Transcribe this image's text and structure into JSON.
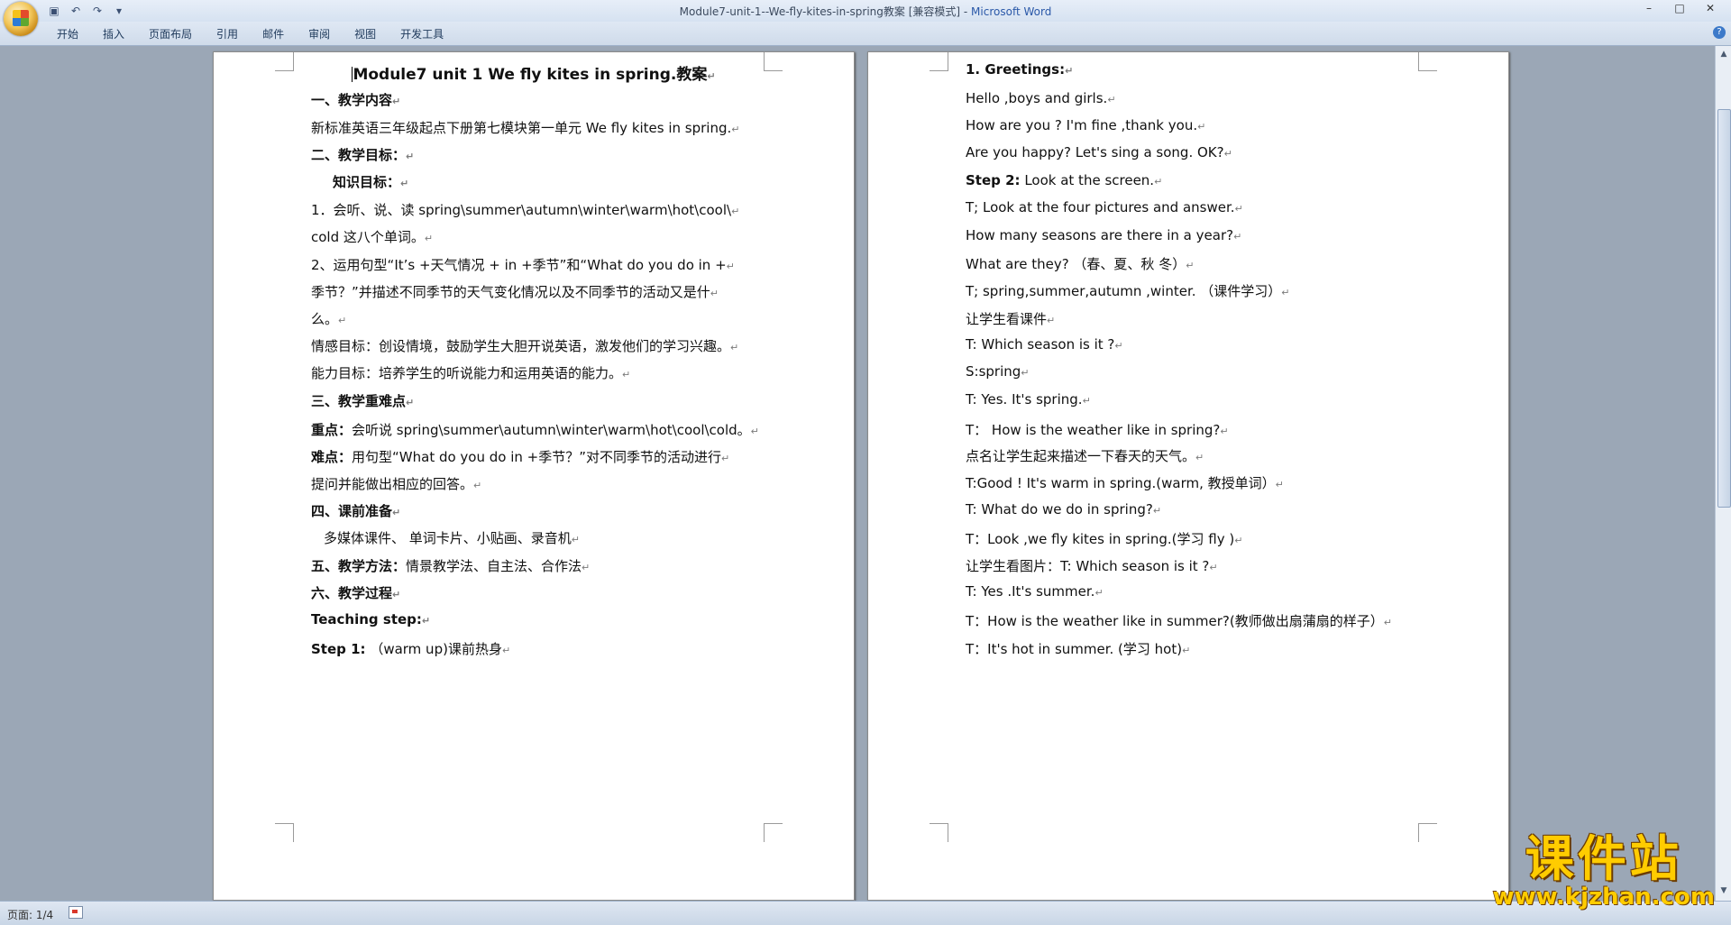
{
  "window": {
    "title": "Module7-unit-1--We-fly-kites-in-spring教案 [兼容模式] - ",
    "app_name": "Microsoft Word",
    "controls": [
      "–",
      "□",
      "✕"
    ]
  },
  "quick_access": [
    "save-icon",
    "undo-icon",
    "redo-icon",
    "customize-icon"
  ],
  "ribbon": {
    "tabs": [
      "开始",
      "插入",
      "页面布局",
      "引用",
      "邮件",
      "审阅",
      "视图",
      "开发工具"
    ]
  },
  "page1": {
    "lines": [
      {
        "text": "Module7 unit 1    We fly kites in spring.教案",
        "bold": true
      },
      {
        "text": "一、教学内容",
        "bold": true
      },
      {
        "text": "新标准英语三年级起点下册第七模块第一单元 We fly kites in spring.",
        "bold": false
      },
      {
        "text": "二、教学目标：",
        "bold": true
      },
      {
        "text": "知识目标：",
        "bold": true
      },
      {
        "text": "1．会听、说、读 spring\\summer\\autumn\\winter\\warm\\hot\\cool\\",
        "bold": false
      },
      {
        "text": "cold 这八个单词。",
        "bold": false
      },
      {
        "text": "2、运用句型“It’s +天气情况 + in +季节”和“What do you do in +",
        "bold": false
      },
      {
        "text": "季节？”并描述不同季节的天气变化情况以及不同季节的活动又是什",
        "bold": false
      },
      {
        "text": "么。",
        "bold": false
      },
      {
        "text": "情感目标：创设情境，鼓励学生大胆开说英语，激发他们的学习兴趣。",
        "bold": false
      },
      {
        "text": "能力目标：培养学生的听说能力和运用英语的能力。",
        "bold": false
      },
      {
        "text": "三、教学重难点",
        "bold": true
      },
      {
        "label": "重点：",
        "text": "会听说 spring\\summer\\autumn\\winter\\warm\\hot\\cool\\cold。",
        "bold": false
      },
      {
        "label": "难点：",
        "text": "用句型“What do you do in +季节？”对不同季节的活动进行",
        "bold": false
      },
      {
        "text": "提问并能做出相应的回答。",
        "bold": false
      },
      {
        "text": "四、课前准备",
        "bold": true
      },
      {
        "text": "多媒体课件、 单词卡片、小贴画、录音机",
        "bold": false
      },
      {
        "label": "五、教学方法：",
        "text": "情景教学法、自主法、合作法",
        "bold": false
      },
      {
        "text": "六、教学过程",
        "bold": true
      },
      {
        "text": "Teaching step:",
        "bold": true
      },
      {
        "label": "Step 1:",
        "text": " （warm up)课前热身",
        "bold": false
      }
    ]
  },
  "page2": {
    "lines": [
      {
        "text": "1. Greetings:",
        "bold": true
      },
      {
        "text": " Hello ,boys and girls.",
        "bold": false
      },
      {
        "text": "How are you ? I'm fine ,thank you.",
        "bold": false
      },
      {
        "text": "Are you happy? Let's sing a song. OK?",
        "bold": false
      },
      {
        "label": "Step 2:",
        "text": " Look at the screen.",
        "bold": false
      },
      {
        "text": "T; Look at the four pictures and answer.",
        "bold": false
      },
      {
        "text": "How many seasons are there in a year?",
        "bold": false
      },
      {
        "text": "What are they? （春、夏、秋 冬）",
        "bold": false
      },
      {
        "text": "T; spring,summer,autumn ,winter. （课件学习）",
        "bold": false
      },
      {
        "text": "让学生看课件",
        "bold": false
      },
      {
        "text": "T: Which season is it ?",
        "bold": false
      },
      {
        "text": "S:spring",
        "bold": false
      },
      {
        "text": "T: Yes. It's spring.",
        "bold": false
      },
      {
        "text": "T： How is the weather like in spring?",
        "bold": false
      },
      {
        "text": "点名让学生起来描述一下春天的天气。",
        "bold": false
      },
      {
        "text": "T:Good ! It's warm in spring.(warm, 教授单词）",
        "bold": false
      },
      {
        "text": "T: What do we do in spring?",
        "bold": false
      },
      {
        "text": "T：Look ,we fly kites in spring.(学习 fly )",
        "bold": false
      },
      {
        "text": "让学生看图片：T: Which season is it ?",
        "bold": false
      },
      {
        "text": "T: Yes .It's summer.",
        "bold": false
      },
      {
        "text": "T：How is the weather like in summer?(教师做出扇蒲扇的样子）",
        "bold": false
      },
      {
        "text": "T：It's hot in summer. (学习 hot)",
        "bold": false
      }
    ]
  },
  "status": {
    "page_indicator": "页面: 1/4"
  },
  "watermark": {
    "title": "课件站",
    "url": "www.kjzhan.com"
  }
}
